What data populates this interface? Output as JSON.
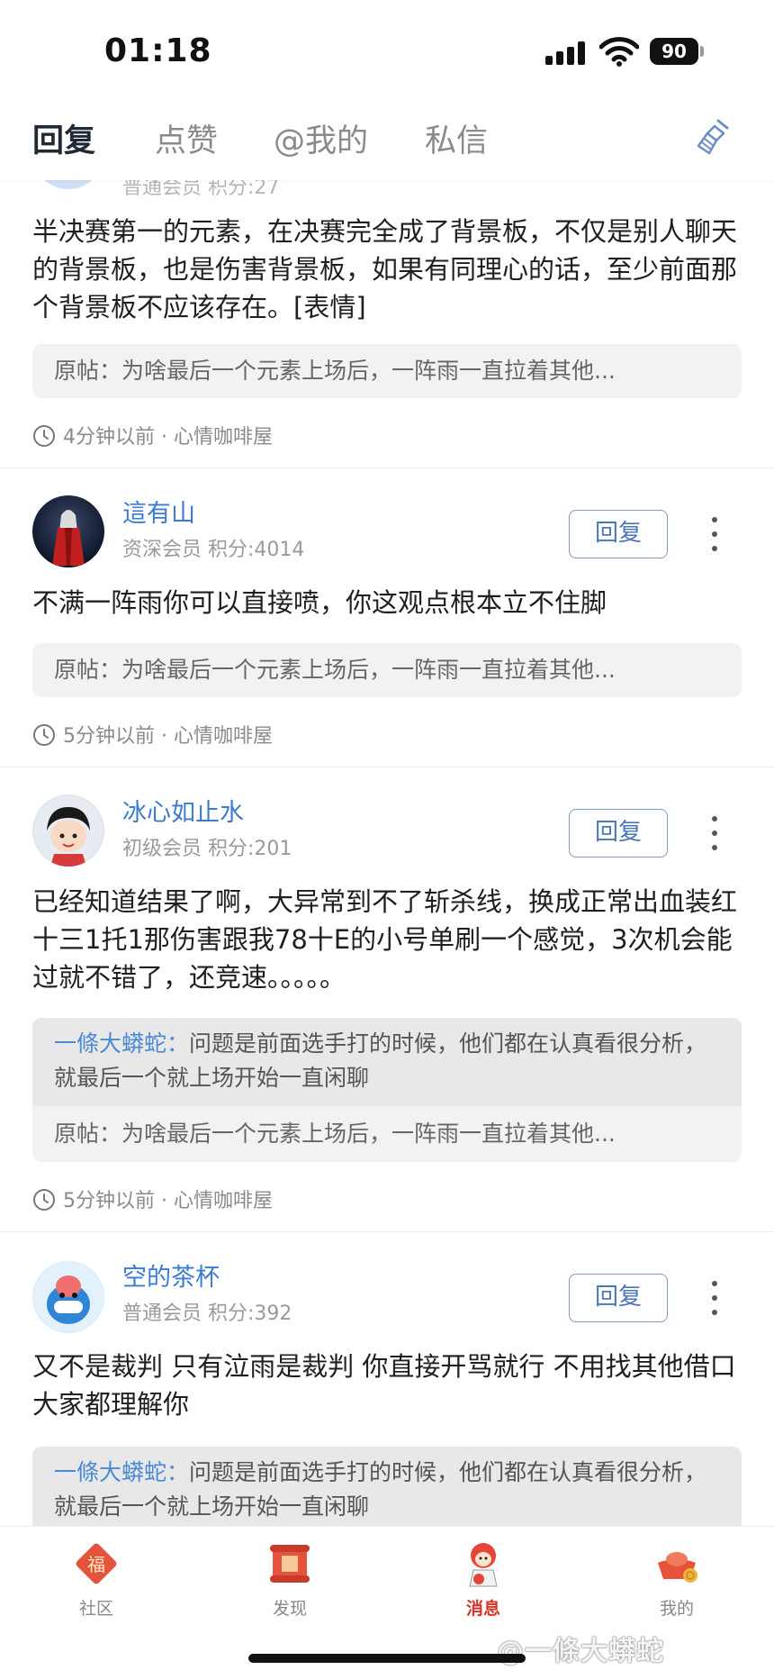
{
  "status_bar": {
    "time": "01:18",
    "battery": "90"
  },
  "tabs": [
    {
      "label": "回复",
      "active": true
    },
    {
      "label": "点赞",
      "active": false
    },
    {
      "label": "@我的",
      "active": false
    },
    {
      "label": "私信",
      "active": false
    }
  ],
  "clear_icon": "broom-icon",
  "posts": [
    {
      "username": "",
      "member": "普通会员 积分:27",
      "content": "半决赛第一的元素，在决赛完全成了背景板，不仅是别人聊天的背景板，也是伤害背景板，如果有同理心的话，至少前面那个背景板不应该存在。[表情]",
      "original": "原帖：为啥最后一个元素上场后，一阵雨一直拉着其他...",
      "time": "4分钟以前 · 心情咖啡屋"
    },
    {
      "username": "這有山",
      "member": "资深会员 积分:4014",
      "reply_label": "回复",
      "content": "不满一阵雨你可以直接喷，你这观点根本立不住脚",
      "original": "原帖：为啥最后一个元素上场后，一阵雨一直拉着其他...",
      "time": "5分钟以前 · 心情咖啡屋"
    },
    {
      "username": "冰心如止水",
      "member": "初级会员 积分:201",
      "reply_label": "回复",
      "content": "已经知道结果了啊，大异常到不了斩杀线，换成正常出血装红十三1托1那伤害跟我78十E的小号单刷一个感觉，3次机会能过就不错了，还竞速。。。。。",
      "quoted_user": "一條大蟒蛇：",
      "quoted_text": "问题是前面选手打的时候，他们都在认真看很分析，就最后一个就上场开始一直闲聊",
      "original": "原帖：为啥最后一个元素上场后，一阵雨一直拉着其他...",
      "time": "5分钟以前 · 心情咖啡屋"
    },
    {
      "username": "空的茶杯",
      "member": "普通会员 积分:392",
      "reply_label": "回复",
      "content": "又不是裁判 只有泣雨是裁判 你直接开骂就行 不用找其他借口 大家都理解你",
      "quoted_user": "一條大蟒蛇：",
      "quoted_text": "问题是前面选手打的时候，他们都在认真看很分析，就最后一个就上场开始一直闲聊"
    }
  ],
  "bottom_nav": [
    {
      "label": "社区",
      "icon": "fu-community-icon",
      "active": false
    },
    {
      "label": "发现",
      "icon": "discover-scroll-icon",
      "active": false
    },
    {
      "label": "消息",
      "icon": "message-mascot-icon",
      "active": true
    },
    {
      "label": "我的",
      "icon": "gold-ingot-icon",
      "active": false
    }
  ],
  "watermark": "@一條大蟒蛇",
  "colors": {
    "accent_blue": "#3b7bd1",
    "active_red": "#d9342b"
  }
}
